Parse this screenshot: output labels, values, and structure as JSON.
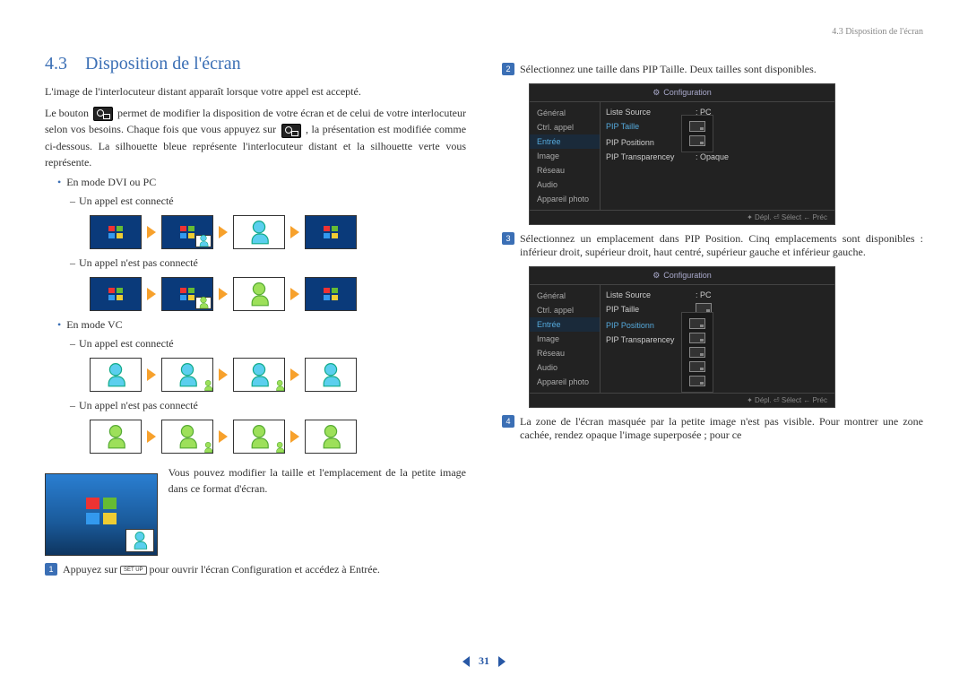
{
  "header": {
    "breadcrumb": "4.3 Disposition de l'écran"
  },
  "section": {
    "number": "4.3",
    "title": "Disposition de l'écran"
  },
  "intro": {
    "p1": "L'image de l'interlocuteur distant apparaît lorsque votre appel est accepté.",
    "p2a": "Le bouton ",
    "p2b": " permet de modifier la disposition de votre écran et de celui de votre interlocuteur selon vos besoins. Chaque fois que vous appuyez sur ",
    "p2c": ", la présentation est modifiée comme ci-dessous. La silhouette bleue représente l'interlocuteur distant et la silhouette verte vous représente."
  },
  "modes": {
    "dvi": "En mode DVI ou PC",
    "vc": "En mode VC",
    "connected": "Un appel est connecté",
    "not_connected": "Un appel n'est pas connecté"
  },
  "explain": "Vous pouvez modifier la taille et l'emplace­ment de la petite image dans ce format d'é­cran.",
  "steps": {
    "s1a": "Appuyez sur ",
    "s1b": " pour ouvrir l'écran Configuration et accédez à En­trée.",
    "s2": "Sélectionnez une taille dans PIP Taille. Deux tailles sont disponibles.",
    "s3": "Sélectionnez un emplacement dans PIP Position. Cinq emplacements sont disponibles : inférieur droit, supérieur droit, haut centré, supérieur gauche et inférieur gauche.",
    "s4": "La zone de l'écran masquée par la petite image n'est pas visible. Pour montrer une zone cachée, rendez opaque l'image superposée ; pour ce"
  },
  "button_setup": "SET UP",
  "osd": {
    "title": "Configuration",
    "side": [
      "Général",
      "Ctrl. appel",
      "Entrée",
      "Image",
      "Réseau",
      "Audio",
      "Appareil photo"
    ],
    "active_index": 2,
    "rows": {
      "source": {
        "lbl": "Liste Source",
        "val": ": PC"
      },
      "pip_size": {
        "lbl": "PIP Taille",
        "val": ""
      },
      "pip_pos": {
        "lbl": "PIP Positionn",
        "val": ""
      },
      "pip_trans": {
        "lbl": "PIP Transparencey",
        "val": ": Opaque"
      }
    },
    "foot": "✦ Dépl.     ⏎ Sélect  ← Préc"
  },
  "pager": {
    "num": "31"
  }
}
